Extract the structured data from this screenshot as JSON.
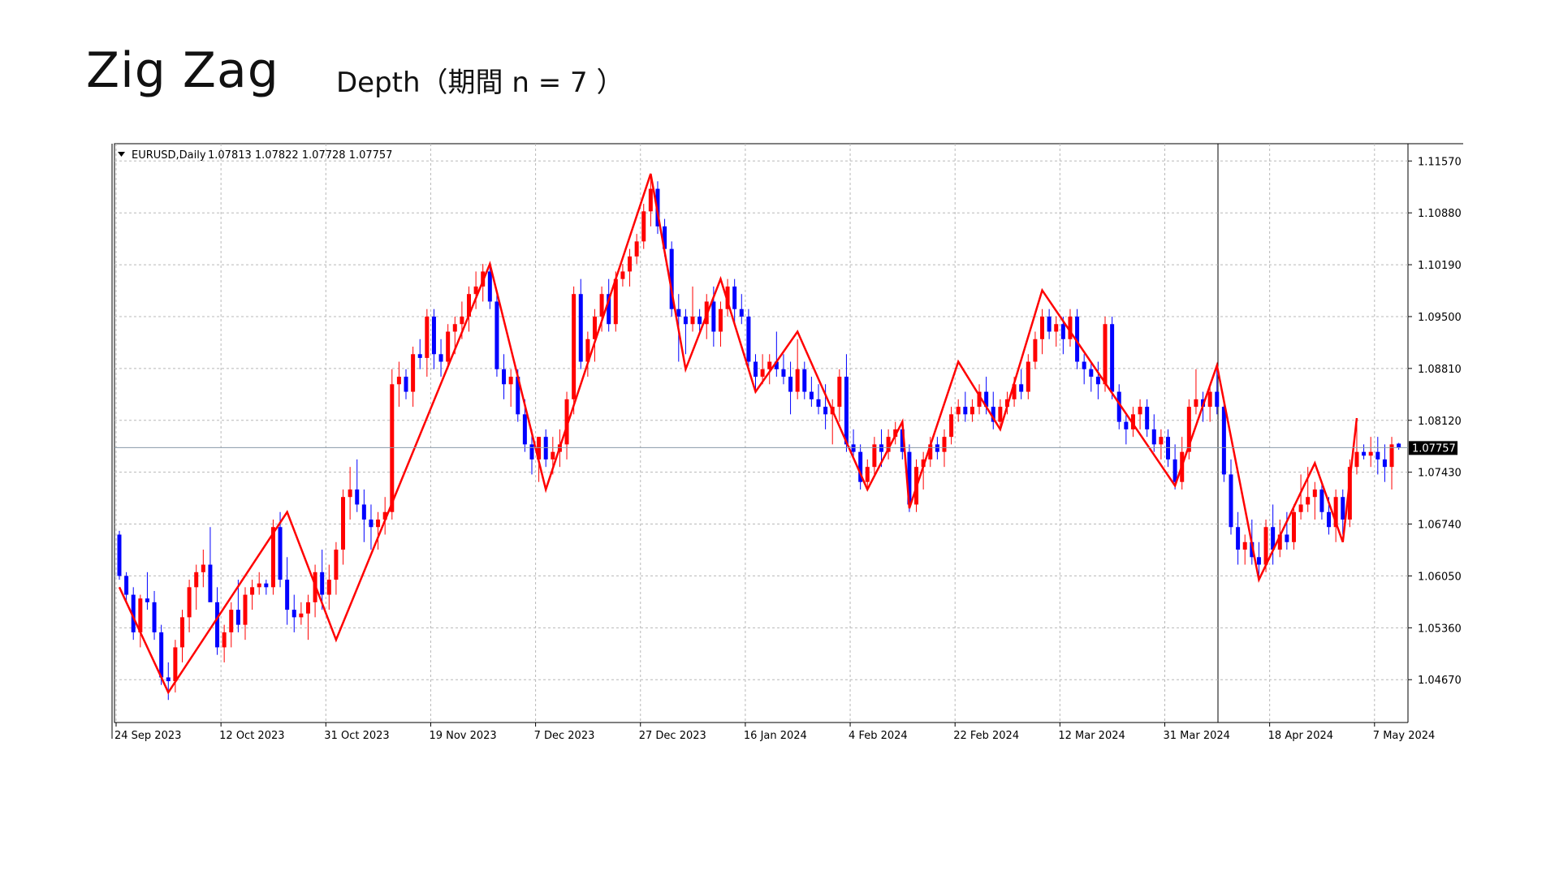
{
  "header": {
    "title": "Zig Zag",
    "subtitle": "Depth（期間 n = 7 ）"
  },
  "chart_data": {
    "type": "candlestick",
    "symbol_label": "EURUSD,Daily",
    "ohlc_label": "1.07813 1.07822 1.07728 1.07757",
    "current_price_label": "1.07757",
    "current_price": 1.07757,
    "ylim": [
      1.041,
      1.118
    ],
    "y_ticks": [
      "1.11570",
      "1.10880",
      "1.10190",
      "1.09500",
      "1.08810",
      "1.08120",
      "1.07430",
      "1.06740",
      "1.06050",
      "1.05360",
      "1.04670"
    ],
    "x_ticks": [
      {
        "label": "24 Sep 2023",
        "index": 0
      },
      {
        "label": "12 Oct 2023",
        "index": 15
      },
      {
        "label": "31 Oct 2023",
        "index": 30
      },
      {
        "label": "19 Nov 2023",
        "index": 45
      },
      {
        "label": "7 Dec 2023",
        "index": 60
      },
      {
        "label": "27 Dec 2023",
        "index": 75
      },
      {
        "label": "16 Jan 2024",
        "index": 90
      },
      {
        "label": "4 Feb 2024",
        "index": 105
      },
      {
        "label": "22 Feb 2024",
        "index": 120
      },
      {
        "label": "12 Mar 2024",
        "index": 135
      },
      {
        "label": "31 Mar 2024",
        "index": 150
      },
      {
        "label": "18 Apr 2024",
        "index": 165
      },
      {
        "label": "7 May 2024",
        "index": 180
      }
    ],
    "grid": true,
    "colors": {
      "up": "#ff0000",
      "down": "#0000ff",
      "zigzag": "#ff0000",
      "grid": "#b8b8b8",
      "price_line": "#8a9aa8"
    },
    "zigzag": [
      {
        "index": 0,
        "price": 1.059
      },
      {
        "index": 7,
        "price": 1.045
      },
      {
        "index": 24,
        "price": 1.069
      },
      {
        "index": 31,
        "price": 1.052
      },
      {
        "index": 53,
        "price": 1.102
      },
      {
        "index": 61,
        "price": 1.072
      },
      {
        "index": 76,
        "price": 1.114
      },
      {
        "index": 81,
        "price": 1.088
      },
      {
        "index": 86,
        "price": 1.1
      },
      {
        "index": 91,
        "price": 1.085
      },
      {
        "index": 97,
        "price": 1.093
      },
      {
        "index": 107,
        "price": 1.072
      },
      {
        "index": 112,
        "price": 1.081
      },
      {
        "index": 113,
        "price": 1.0695
      },
      {
        "index": 120,
        "price": 1.089
      },
      {
        "index": 126,
        "price": 1.08
      },
      {
        "index": 132,
        "price": 1.0985
      },
      {
        "index": 151,
        "price": 1.0725
      },
      {
        "index": 157,
        "price": 1.0885
      },
      {
        "index": 163,
        "price": 1.06
      },
      {
        "index": 171,
        "price": 1.0755
      },
      {
        "index": 175,
        "price": 1.065
      },
      {
        "index": 177,
        "price": 1.0815
      }
    ],
    "candles": [
      [
        1.066,
        1.0665,
        1.06,
        1.0605
      ],
      [
        1.0605,
        1.061,
        1.057,
        1.058
      ],
      [
        1.058,
        1.059,
        1.052,
        1.053
      ],
      [
        1.053,
        1.058,
        1.051,
        1.0575
      ],
      [
        1.0575,
        1.061,
        1.056,
        1.057
      ],
      [
        1.057,
        1.0585,
        1.052,
        1.053
      ],
      [
        1.053,
        1.054,
        1.046,
        1.047
      ],
      [
        1.047,
        1.049,
        1.044,
        1.0465
      ],
      [
        1.0465,
        1.052,
        1.045,
        1.051
      ],
      [
        1.051,
        1.056,
        1.049,
        1.055
      ],
      [
        1.055,
        1.06,
        1.053,
        1.059
      ],
      [
        1.059,
        1.062,
        1.056,
        1.061
      ],
      [
        1.061,
        1.064,
        1.059,
        1.062
      ],
      [
        1.062,
        1.067,
        1.06,
        1.057
      ],
      [
        1.057,
        1.059,
        1.05,
        1.051
      ],
      [
        1.051,
        1.054,
        1.049,
        1.053
      ],
      [
        1.053,
        1.057,
        1.051,
        1.056
      ],
      [
        1.056,
        1.06,
        1.053,
        1.054
      ],
      [
        1.054,
        1.059,
        1.052,
        1.058
      ],
      [
        1.058,
        1.06,
        1.056,
        1.059
      ],
      [
        1.059,
        1.061,
        1.058,
        1.0595
      ],
      [
        1.0595,
        1.06,
        1.058,
        1.059
      ],
      [
        1.059,
        1.068,
        1.058,
        1.067
      ],
      [
        1.067,
        1.069,
        1.059,
        1.06
      ],
      [
        1.06,
        1.063,
        1.054,
        1.056
      ],
      [
        1.056,
        1.058,
        1.053,
        1.055
      ],
      [
        1.055,
        1.057,
        1.054,
        1.0555
      ],
      [
        1.0555,
        1.058,
        1.052,
        1.057
      ],
      [
        1.057,
        1.062,
        1.055,
        1.061
      ],
      [
        1.061,
        1.064,
        1.056,
        1.058
      ],
      [
        1.058,
        1.062,
        1.056,
        1.06
      ],
      [
        1.06,
        1.065,
        1.058,
        1.064
      ],
      [
        1.064,
        1.072,
        1.062,
        1.071
      ],
      [
        1.071,
        1.075,
        1.068,
        1.072
      ],
      [
        1.072,
        1.076,
        1.069,
        1.07
      ],
      [
        1.07,
        1.072,
        1.065,
        1.068
      ],
      [
        1.068,
        1.07,
        1.064,
        1.067
      ],
      [
        1.067,
        1.069,
        1.064,
        1.068
      ],
      [
        1.068,
        1.071,
        1.066,
        1.069
      ],
      [
        1.069,
        1.088,
        1.068,
        1.086
      ],
      [
        1.086,
        1.089,
        1.083,
        1.087
      ],
      [
        1.087,
        1.088,
        1.084,
        1.085
      ],
      [
        1.085,
        1.091,
        1.083,
        1.09
      ],
      [
        1.09,
        1.092,
        1.088,
        1.0895
      ],
      [
        1.0895,
        1.096,
        1.087,
        1.095
      ],
      [
        1.095,
        1.096,
        1.088,
        1.09
      ],
      [
        1.09,
        1.092,
        1.087,
        1.089
      ],
      [
        1.089,
        1.094,
        1.088,
        1.093
      ],
      [
        1.093,
        1.095,
        1.09,
        1.094
      ],
      [
        1.094,
        1.097,
        1.092,
        1.095
      ],
      [
        1.095,
        1.099,
        1.093,
        1.098
      ],
      [
        1.098,
        1.101,
        1.096,
        1.099
      ],
      [
        1.099,
        1.102,
        1.097,
        1.101
      ],
      [
        1.101,
        1.102,
        1.096,
        1.097
      ],
      [
        1.097,
        1.098,
        1.087,
        1.088
      ],
      [
        1.088,
        1.09,
        1.084,
        1.086
      ],
      [
        1.086,
        1.088,
        1.083,
        1.087
      ],
      [
        1.087,
        1.088,
        1.081,
        1.082
      ],
      [
        1.082,
        1.084,
        1.077,
        1.078
      ],
      [
        1.078,
        1.08,
        1.074,
        1.076
      ],
      [
        1.076,
        1.079,
        1.073,
        1.079
      ],
      [
        1.079,
        1.08,
        1.075,
        1.076
      ],
      [
        1.076,
        1.079,
        1.074,
        1.077
      ],
      [
        1.077,
        1.08,
        1.075,
        1.078
      ],
      [
        1.078,
        1.085,
        1.076,
        1.084
      ],
      [
        1.084,
        1.099,
        1.082,
        1.098
      ],
      [
        1.098,
        1.1,
        1.088,
        1.089
      ],
      [
        1.089,
        1.093,
        1.087,
        1.092
      ],
      [
        1.092,
        1.096,
        1.089,
        1.095
      ],
      [
        1.095,
        1.099,
        1.093,
        1.098
      ],
      [
        1.098,
        1.1,
        1.093,
        1.094
      ],
      [
        1.094,
        1.101,
        1.093,
        1.1
      ],
      [
        1.1,
        1.102,
        1.099,
        1.101
      ],
      [
        1.101,
        1.104,
        1.099,
        1.103
      ],
      [
        1.103,
        1.106,
        1.102,
        1.105
      ],
      [
        1.105,
        1.11,
        1.104,
        1.109
      ],
      [
        1.109,
        1.114,
        1.107,
        1.112
      ],
      [
        1.112,
        1.113,
        1.106,
        1.107
      ],
      [
        1.107,
        1.108,
        1.103,
        1.104
      ],
      [
        1.104,
        1.105,
        1.095,
        1.096
      ],
      [
        1.096,
        1.098,
        1.089,
        1.095
      ],
      [
        1.095,
        1.096,
        1.09,
        1.094
      ],
      [
        1.094,
        1.099,
        1.093,
        1.095
      ],
      [
        1.095,
        1.096,
        1.093,
        1.094
      ],
      [
        1.094,
        1.098,
        1.092,
        1.097
      ],
      [
        1.097,
        1.099,
        1.091,
        1.093
      ],
      [
        1.093,
        1.097,
        1.091,
        1.096
      ],
      [
        1.096,
        1.1,
        1.095,
        1.099
      ],
      [
        1.099,
        1.1,
        1.094,
        1.096
      ],
      [
        1.096,
        1.098,
        1.094,
        1.095
      ],
      [
        1.095,
        1.096,
        1.088,
        1.089
      ],
      [
        1.089,
        1.09,
        1.085,
        1.087
      ],
      [
        1.087,
        1.09,
        1.086,
        1.088
      ],
      [
        1.088,
        1.09,
        1.086,
        1.089
      ],
      [
        1.089,
        1.093,
        1.087,
        1.088
      ],
      [
        1.088,
        1.09,
        1.086,
        1.087
      ],
      [
        1.087,
        1.089,
        1.082,
        1.085
      ],
      [
        1.085,
        1.092,
        1.084,
        1.088
      ],
      [
        1.088,
        1.089,
        1.084,
        1.085
      ],
      [
        1.085,
        1.087,
        1.083,
        1.084
      ],
      [
        1.084,
        1.086,
        1.082,
        1.083
      ],
      [
        1.083,
        1.086,
        1.08,
        1.082
      ],
      [
        1.082,
        1.084,
        1.078,
        1.083
      ],
      [
        1.083,
        1.088,
        1.081,
        1.087
      ],
      [
        1.087,
        1.09,
        1.077,
        1.078
      ],
      [
        1.078,
        1.08,
        1.076,
        1.077
      ],
      [
        1.077,
        1.078,
        1.072,
        1.073
      ],
      [
        1.073,
        1.076,
        1.072,
        1.075
      ],
      [
        1.075,
        1.079,
        1.074,
        1.078
      ],
      [
        1.078,
        1.08,
        1.075,
        1.077
      ],
      [
        1.077,
        1.08,
        1.076,
        1.079
      ],
      [
        1.079,
        1.081,
        1.078,
        1.08
      ],
      [
        1.08,
        1.081,
        1.076,
        1.077
      ],
      [
        1.077,
        1.078,
        1.069,
        1.07
      ],
      [
        1.07,
        1.076,
        1.069,
        1.075
      ],
      [
        1.075,
        1.077,
        1.072,
        1.076
      ],
      [
        1.076,
        1.079,
        1.075,
        1.078
      ],
      [
        1.078,
        1.079,
        1.076,
        1.077
      ],
      [
        1.077,
        1.08,
        1.075,
        1.079
      ],
      [
        1.079,
        1.083,
        1.078,
        1.082
      ],
      [
        1.082,
        1.084,
        1.081,
        1.083
      ],
      [
        1.083,
        1.085,
        1.081,
        1.082
      ],
      [
        1.082,
        1.084,
        1.081,
        1.083
      ],
      [
        1.083,
        1.086,
        1.082,
        1.085
      ],
      [
        1.085,
        1.087,
        1.082,
        1.083
      ],
      [
        1.083,
        1.085,
        1.08,
        1.081
      ],
      [
        1.081,
        1.084,
        1.08,
        1.083
      ],
      [
        1.083,
        1.085,
        1.082,
        1.084
      ],
      [
        1.084,
        1.087,
        1.083,
        1.086
      ],
      [
        1.086,
        1.088,
        1.084,
        1.085
      ],
      [
        1.085,
        1.09,
        1.084,
        1.089
      ],
      [
        1.089,
        1.093,
        1.088,
        1.092
      ],
      [
        1.092,
        1.096,
        1.09,
        1.095
      ],
      [
        1.095,
        1.096,
        1.092,
        1.093
      ],
      [
        1.093,
        1.095,
        1.091,
        1.094
      ],
      [
        1.094,
        1.095,
        1.09,
        1.092
      ],
      [
        1.092,
        1.096,
        1.091,
        1.095
      ],
      [
        1.095,
        1.096,
        1.088,
        1.089
      ],
      [
        1.089,
        1.09,
        1.086,
        1.088
      ],
      [
        1.088,
        1.089,
        1.085,
        1.087
      ],
      [
        1.087,
        1.089,
        1.084,
        1.086
      ],
      [
        1.086,
        1.095,
        1.085,
        1.094
      ],
      [
        1.094,
        1.095,
        1.084,
        1.085
      ],
      [
        1.085,
        1.086,
        1.08,
        1.081
      ],
      [
        1.081,
        1.082,
        1.078,
        1.08
      ],
      [
        1.08,
        1.083,
        1.079,
        1.082
      ],
      [
        1.082,
        1.084,
        1.08,
        1.083
      ],
      [
        1.083,
        1.084,
        1.079,
        1.08
      ],
      [
        1.08,
        1.082,
        1.077,
        1.078
      ],
      [
        1.078,
        1.08,
        1.076,
        1.079
      ],
      [
        1.079,
        1.08,
        1.075,
        1.076
      ],
      [
        1.076,
        1.078,
        1.072,
        1.073
      ],
      [
        1.073,
        1.079,
        1.072,
        1.077
      ],
      [
        1.077,
        1.084,
        1.076,
        1.083
      ],
      [
        1.083,
        1.088,
        1.082,
        1.084
      ],
      [
        1.084,
        1.085,
        1.081,
        1.083
      ],
      [
        1.083,
        1.086,
        1.081,
        1.085
      ],
      [
        1.085,
        1.088,
        1.082,
        1.083
      ],
      [
        1.083,
        1.084,
        1.073,
        1.074
      ],
      [
        1.074,
        1.076,
        1.066,
        1.067
      ],
      [
        1.067,
        1.069,
        1.062,
        1.064
      ],
      [
        1.064,
        1.066,
        1.062,
        1.065
      ],
      [
        1.065,
        1.068,
        1.062,
        1.063
      ],
      [
        1.063,
        1.065,
        1.06,
        1.062
      ],
      [
        1.062,
        1.068,
        1.061,
        1.067
      ],
      [
        1.067,
        1.07,
        1.062,
        1.064
      ],
      [
        1.064,
        1.068,
        1.063,
        1.066
      ],
      [
        1.066,
        1.069,
        1.064,
        1.065
      ],
      [
        1.065,
        1.07,
        1.064,
        1.069
      ],
      [
        1.069,
        1.074,
        1.068,
        1.07
      ],
      [
        1.07,
        1.075,
        1.069,
        1.071
      ],
      [
        1.071,
        1.073,
        1.068,
        1.072
      ],
      [
        1.072,
        1.073,
        1.068,
        1.069
      ],
      [
        1.069,
        1.071,
        1.066,
        1.067
      ],
      [
        1.067,
        1.072,
        1.065,
        1.071
      ],
      [
        1.071,
        1.072,
        1.066,
        1.068
      ],
      [
        1.068,
        1.076,
        1.067,
        1.075
      ],
      [
        1.075,
        1.081,
        1.074,
        1.077
      ],
      [
        1.077,
        1.078,
        1.076,
        1.0765
      ],
      [
        1.0765,
        1.079,
        1.075,
        1.077
      ],
      [
        1.077,
        1.079,
        1.074,
        1.076
      ],
      [
        1.076,
        1.078,
        1.073,
        1.075
      ],
      [
        1.075,
        1.079,
        1.072,
        1.078
      ],
      [
        1.0781,
        1.0782,
        1.0773,
        1.0776
      ]
    ]
  }
}
